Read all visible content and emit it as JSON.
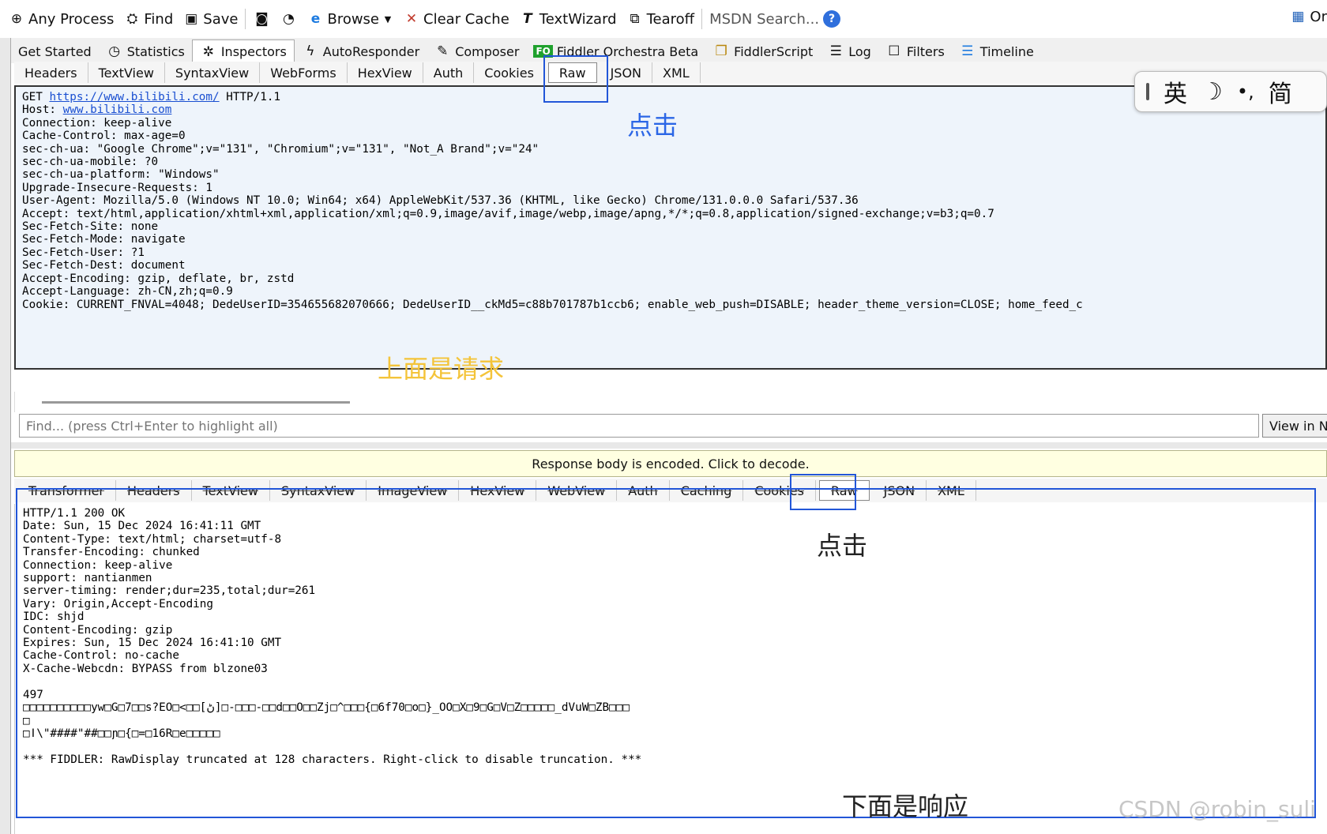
{
  "toolbar": {
    "items": [
      {
        "label": "Any Process",
        "icon": "crosshair-icon"
      },
      {
        "label": "Find",
        "icon": "binoculars-icon"
      },
      {
        "label": "Save",
        "icon": "save-icon"
      },
      {
        "label": "",
        "icon": "camera-icon"
      },
      {
        "label": "",
        "icon": "timer-icon"
      },
      {
        "label": "Browse",
        "icon": "ie-icon"
      },
      {
        "label": "Clear Cache",
        "icon": "clear-cache-icon"
      },
      {
        "label": "TextWizard",
        "icon": "text-wizard-icon"
      },
      {
        "label": "Tearoff",
        "icon": "tearoff-icon"
      }
    ],
    "msdn_search": "MSDN Search...",
    "help_icon": "?",
    "right_label": "Or"
  },
  "inspector_tabs": [
    {
      "label": "Get Started",
      "icon": ""
    },
    {
      "label": "Statistics",
      "icon": "stopwatch-icon"
    },
    {
      "label": "Inspectors",
      "icon": "inspect-icon",
      "active": true
    },
    {
      "label": "AutoResponder",
      "icon": "lightning-icon"
    },
    {
      "label": "Composer",
      "icon": "composer-icon"
    },
    {
      "label": "Fiddler Orchestra Beta",
      "icon": "fo-badge"
    },
    {
      "label": "FiddlerScript",
      "icon": "script-icon"
    },
    {
      "label": "Log",
      "icon": "log-icon"
    },
    {
      "label": "Filters",
      "icon": "checkbox-icon"
    },
    {
      "label": "Timeline",
      "icon": "timeline-icon"
    }
  ],
  "fo_badge": "FO",
  "request_tabs": [
    "Headers",
    "TextView",
    "SyntaxView",
    "WebForms",
    "HexView",
    "Auth",
    "Cookies",
    "Raw",
    "JSON",
    "XML"
  ],
  "request": {
    "method": "GET ",
    "url": "https://www.bilibili.com/",
    "protocol": " HTTP/1.1",
    "host_key": "Host: ",
    "host": "www.bilibili.com",
    "headers": "Connection: keep-alive\nCache-Control: max-age=0\nsec-ch-ua: \"Google Chrome\";v=\"131\", \"Chromium\";v=\"131\", \"Not_A Brand\";v=\"24\"\nsec-ch-ua-mobile: ?0\nsec-ch-ua-platform: \"Windows\"\nUpgrade-Insecure-Requests: 1\nUser-Agent: Mozilla/5.0 (Windows NT 10.0; Win64; x64) AppleWebKit/537.36 (KHTML, like Gecko) Chrome/131.0.0.0 Safari/537.36\nAccept: text/html,application/xhtml+xml,application/xml;q=0.9,image/avif,image/webp,image/apng,*/*;q=0.8,application/signed-exchange;v=b3;q=0.7\nSec-Fetch-Site: none\nSec-Fetch-Mode: navigate\nSec-Fetch-User: ?1\nSec-Fetch-Dest: document\nAccept-Encoding: gzip, deflate, br, zstd\nAccept-Language: zh-CN,zh;q=0.9\nCookie: CURRENT_FNVAL=4048; DedeUserID=354655682070666; DedeUserID__ckMd5=c88b701787b1ccb6; enable_web_push=DISABLE; header_theme_version=CLOSE; home_feed_c"
  },
  "ime": {
    "mode": "英",
    "moon": "☽",
    "punct": "•,",
    "simplified": "简"
  },
  "find": {
    "placeholder": "Find... (press Ctrl+Enter to highlight all)",
    "view_button": "View in N"
  },
  "response_banner": "Response body is encoded. Click to decode.",
  "response_tabs": [
    "Transformer",
    "Headers",
    "TextView",
    "SyntaxView",
    "ImageView",
    "HexView",
    "WebView",
    "Auth",
    "Caching",
    "Cookies",
    "Raw",
    "JSON",
    "XML"
  ],
  "response": {
    "text": "HTTP/1.1 200 OK\nDate: Sun, 15 Dec 2024 16:41:11 GMT\nContent-Type: text/html; charset=utf-8\nTransfer-Encoding: chunked\nConnection: keep-alive\nsupport: nantianmen\nserver-timing: render;dur=235,total;dur=261\nVary: Origin,Accept-Encoding\nIDC: shjd\nContent-Encoding: gzip\nExpires: Sun, 15 Dec 2024 16:41:10 GMT\nCache-Control: no-cache\nX-Cache-Webcdn: BYPASS from blzone03\n\n497\n□□□□□□□□□□yw□G□7□□s?EO□<□□[ڻ]□-□□□-□□d□□O□□Zj□^□□□{□6f70□o□}_OO□X□9□G□V□Z□□□□□_dVuW□ZB□□□\n□\n□ǀ\\\"####\"##□□ɲ□{□=□16R□e□□□□□\n\n*** FIDDLER: RawDisplay truncated at 128 characters. Right-click to disable truncation. ***"
  },
  "annotations": {
    "click_request": "点击",
    "above_is_request": "上面是请求",
    "click_response": "点击",
    "below_is_response": "下面是响应",
    "watermark": "CSDN @robin_suli"
  },
  "colors": {
    "annotation_blue": "#2256d8",
    "annotation_yellow": "#f4c43a",
    "banner": "#ffffe1",
    "request_bg": "#eef4fb"
  }
}
